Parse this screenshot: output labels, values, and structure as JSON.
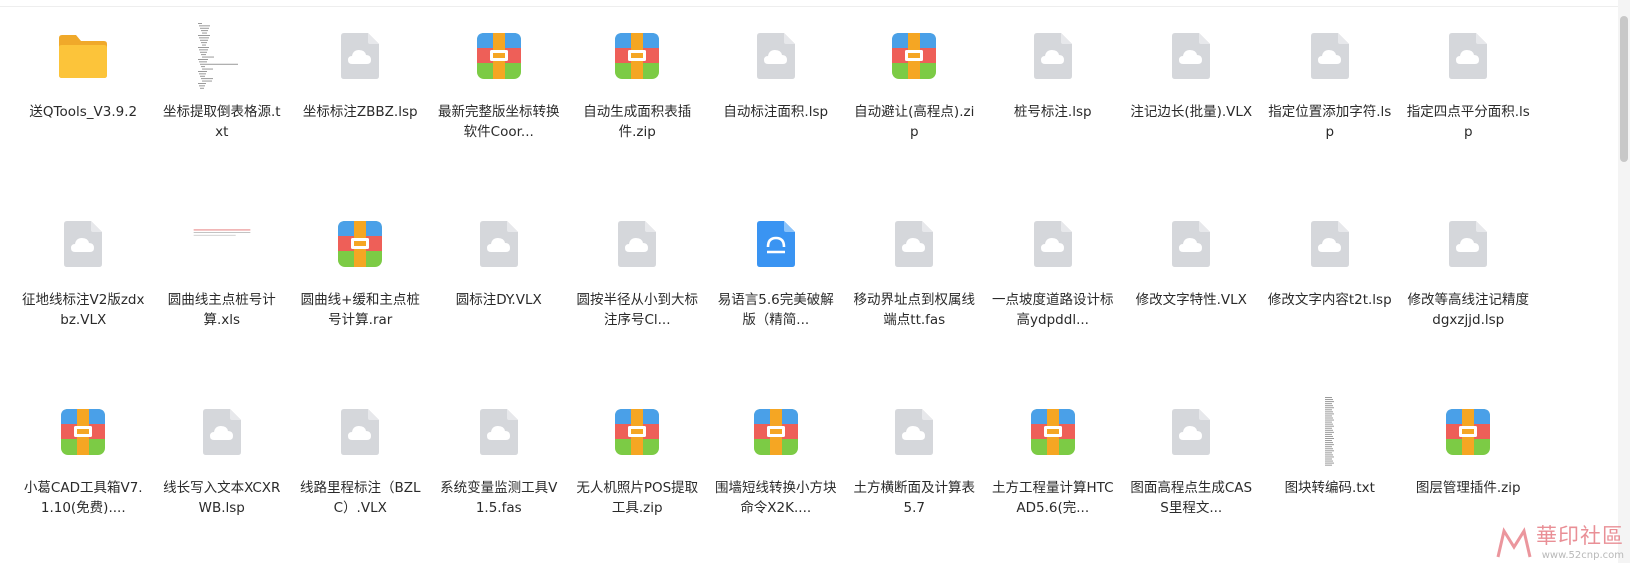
{
  "files": [
    {
      "name": "送QTools_V3.9.2",
      "icon": "folder-icon"
    },
    {
      "name": "坐标提取倒表格源.txt",
      "icon": "txt-preview-icon"
    },
    {
      "name": "坐标标注ZBBZ.lsp",
      "icon": "cloud-file-icon"
    },
    {
      "name": "最新完整版坐标转换软件Coor...",
      "icon": "archive-icon"
    },
    {
      "name": "自动生成面积表插件.zip",
      "icon": "archive-icon"
    },
    {
      "name": "自动标注面积.lsp",
      "icon": "cloud-file-icon"
    },
    {
      "name": "自动避让(高程点).zip",
      "icon": "archive-icon"
    },
    {
      "name": "桩号标注.lsp",
      "icon": "cloud-file-icon"
    },
    {
      "name": "注记边长(批量).VLX",
      "icon": "cloud-file-icon"
    },
    {
      "name": "指定位置添加字符.lsp",
      "icon": "cloud-file-icon"
    },
    {
      "name": "指定四点平分面积.lsp",
      "icon": "cloud-file-icon"
    },
    {
      "name": "征地线标注V2版zdxbz.VLX",
      "icon": "cloud-file-icon"
    },
    {
      "name": "圆曲线主点桩号计算.xls",
      "icon": "xls-preview-icon"
    },
    {
      "name": "圆曲线+缓和主点桩号计算.rar",
      "icon": "archive-icon"
    },
    {
      "name": "圆标注DY.VLX",
      "icon": "cloud-file-icon"
    },
    {
      "name": "圆按半径从小到大标注序号Cl...",
      "icon": "cloud-file-icon"
    },
    {
      "name": "易语言5.6完美破解版（精简...",
      "icon": "installer-icon"
    },
    {
      "name": "移动界址点到权属线端点tt.fas",
      "icon": "cloud-file-icon"
    },
    {
      "name": "一点坡度道路设计标高ydpddl...",
      "icon": "cloud-file-icon"
    },
    {
      "name": "修改文字特性.VLX",
      "icon": "cloud-file-icon"
    },
    {
      "name": "修改文字内容t2t.lsp",
      "icon": "cloud-file-icon"
    },
    {
      "name": "修改等高线注记精度dgxzjjd.lsp",
      "icon": "cloud-file-icon"
    },
    {
      "name": "小葛CAD工具箱V7.1.10(免费)....",
      "icon": "archive-icon"
    },
    {
      "name": "线长写入文本XCXRWB.lsp",
      "icon": "cloud-file-icon"
    },
    {
      "name": "线路里程标注（BZLC）.VLX",
      "icon": "cloud-file-icon"
    },
    {
      "name": "系统变量监测工具V1.5.fas",
      "icon": "cloud-file-icon"
    },
    {
      "name": "无人机照片POS提取工具.zip",
      "icon": "archive-icon"
    },
    {
      "name": "围墙短线转换小方块命令X2K....",
      "icon": "archive-icon"
    },
    {
      "name": "土方横断面及计算表5.7",
      "icon": "cloud-file-icon"
    },
    {
      "name": "土方工程量计算HTCAD5.6(完...",
      "icon": "archive-icon"
    },
    {
      "name": "图面高程点生成CASS里程文...",
      "icon": "cloud-file-icon"
    },
    {
      "name": "图块转编码.txt",
      "icon": "txt-column-preview-icon"
    },
    {
      "name": "图层管理插件.zip",
      "icon": "archive-icon"
    }
  ],
  "watermark": {
    "text": "華印社區",
    "url": "www.52cnp.com"
  },
  "colors": {
    "folder": "#fcc43a",
    "generic_file": "#d5d7db",
    "archive_blue": "#4aa0e8",
    "archive_red": "#ee5f58",
    "archive_green": "#7ccb45",
    "archive_band": "#f5a623",
    "installer": "#3a94f2"
  }
}
